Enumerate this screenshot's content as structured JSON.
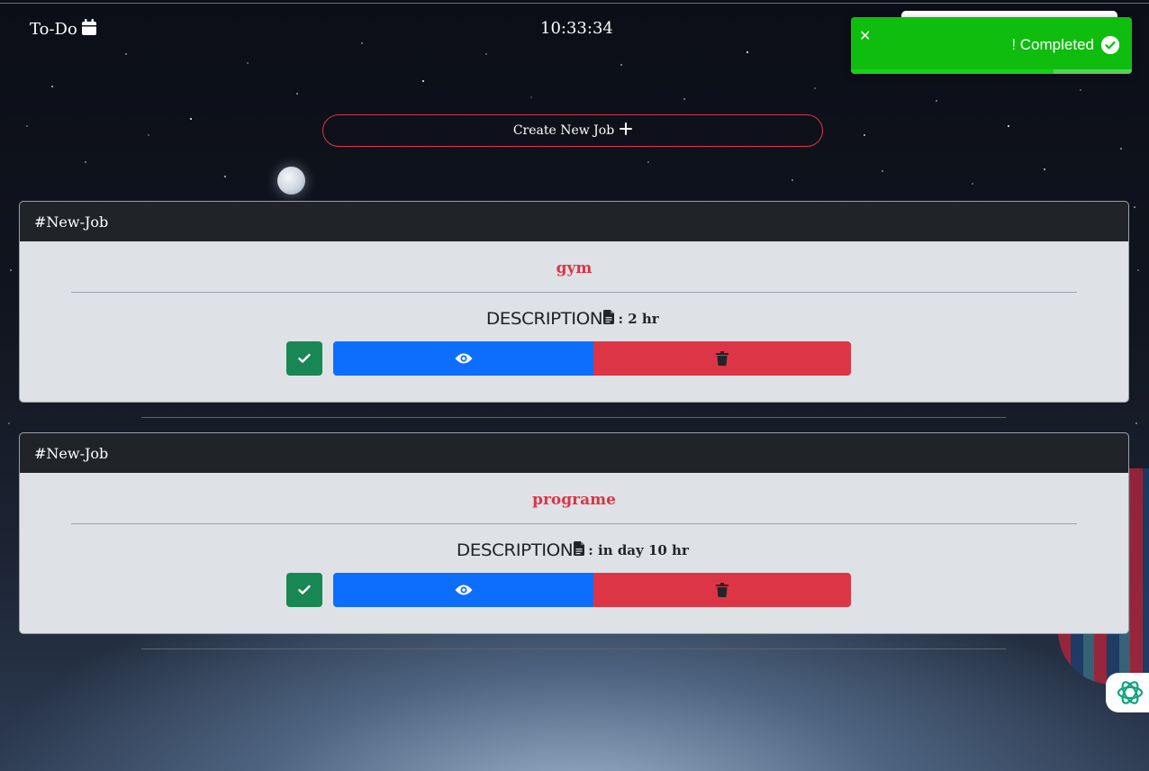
{
  "header": {
    "app_title": "To-Do",
    "app_icon": "calendar-icon",
    "clock": "10:33:34"
  },
  "toast": {
    "message": "! Completed",
    "close_icon": "close-icon",
    "status_icon": "check-circle-icon",
    "color": "#0ebd0e",
    "progress": 0.72
  },
  "create_button": {
    "label": "Create New Job",
    "icon": "plus-icon"
  },
  "jobs": [
    {
      "tag": "#New-Job",
      "title": "gym",
      "description_label": "DESCRIPTION",
      "description_value": ": 2 hr"
    },
    {
      "tag": "#New-Job",
      "title": "programe",
      "description_label": "DESCRIPTION",
      "description_value": ": in day 10 hr"
    }
  ],
  "colors": {
    "done": "#198754",
    "view": "#0d6efd",
    "delete": "#dc3545",
    "accent_red": "#dc3545"
  }
}
